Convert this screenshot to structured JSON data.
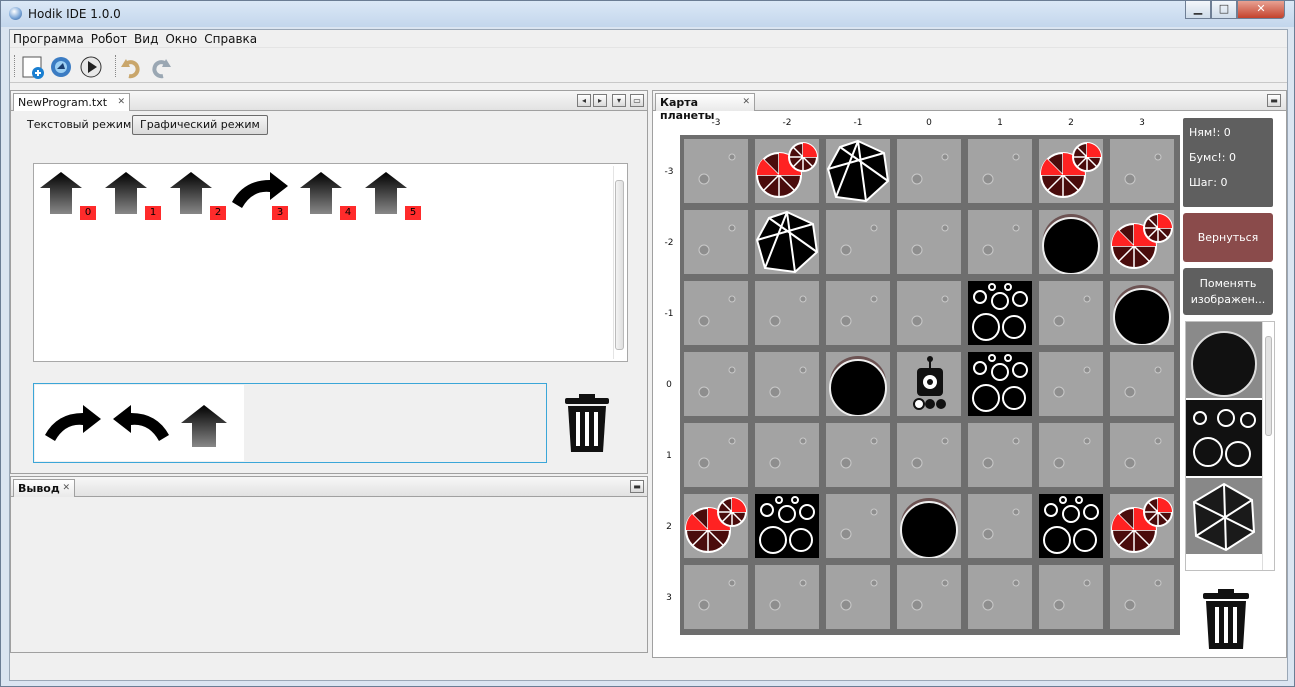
{
  "window": {
    "title": "Hodik IDE 1.0.0",
    "min": "▁",
    "max": "□",
    "close": "✕"
  },
  "menu": [
    "Программа",
    "Робот",
    "Вид",
    "Окно",
    "Справка"
  ],
  "toolbar": {
    "items": [
      "new-program-icon",
      "run-debug-icon",
      "play-icon",
      "undo-icon",
      "redo-icon"
    ]
  },
  "editor": {
    "tab_label": "NewProgram.txt",
    "tab_close": "✕",
    "modes": {
      "text": "Текстовый режим",
      "graphic": "Графический режим"
    },
    "program": [
      {
        "icon": "forward-arrow-icon",
        "index": "0"
      },
      {
        "icon": "forward-arrow-icon",
        "index": "1"
      },
      {
        "icon": "forward-arrow-icon",
        "index": "2"
      },
      {
        "icon": "turn-right-icon",
        "index": "3"
      },
      {
        "icon": "forward-arrow-icon",
        "index": "4"
      },
      {
        "icon": "forward-arrow-icon",
        "index": "5"
      }
    ],
    "palette": [
      "turn-right-icon",
      "turn-left-icon",
      "forward-arrow-icon"
    ]
  },
  "output": {
    "tab_label": "Вывод",
    "tab_close": "✕"
  },
  "map": {
    "tab_label": "Карта планеты",
    "tab_close": "✕",
    "x_labels": [
      "-3",
      "-2",
      "-1",
      "0",
      "1",
      "2",
      "3"
    ],
    "y_labels": [
      "-3",
      "-2",
      "-1",
      "0",
      "1",
      "2",
      "3"
    ],
    "stats": {
      "nyam": "Ням!: 0",
      "bums": "Бумс!: 0",
      "step": "Шаг: 0"
    },
    "buttons": {
      "back": "Вернуться",
      "change_image": "Поменять изображен..."
    },
    "accent": "#8a4b4b"
  }
}
